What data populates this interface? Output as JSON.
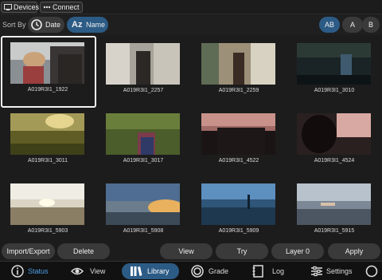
{
  "topbar": {
    "devices_label": "Devices",
    "connect_label": "Connect",
    "devices_icon": "monitor-icon",
    "connect_icon": "dots-icon"
  },
  "sort": {
    "label": "Sort By",
    "date_label": "Date",
    "name_label": "Name",
    "name_icon_text": "Az",
    "active": "name"
  },
  "banks": {
    "items": [
      "AB",
      "A",
      "B"
    ],
    "active": "AB"
  },
  "clips": [
    {
      "name": "A019R3I1_1922",
      "selected": true
    },
    {
      "name": "A019R3I1_2257"
    },
    {
      "name": "A019R3I1_2259"
    },
    {
      "name": "A019R3I1_3010"
    },
    {
      "name": "A019R3I1_3011"
    },
    {
      "name": "A019R3I1_3017"
    },
    {
      "name": "A019R3I1_4522"
    },
    {
      "name": "A019R3I1_4524"
    },
    {
      "name": "A019R3I1_5903"
    },
    {
      "name": "A019R3I1_5908"
    },
    {
      "name": "A019R3I1_5909"
    },
    {
      "name": "A019R3I1_5915"
    }
  ],
  "actions": {
    "import_export": "Import/Export",
    "delete": "Delete",
    "view": "View",
    "try": "Try",
    "layer": "Layer 0",
    "apply": "Apply"
  },
  "nav": {
    "status": "Status",
    "view": "View",
    "library": "Library",
    "grade": "Grade",
    "log": "Log",
    "settings": "Settings",
    "active": "library"
  },
  "colors": {
    "accent": "#2c5b85",
    "status_text": "#4d9ee8",
    "button_bg": "#3a3a3a",
    "panel_bg": "#1c1c1c"
  }
}
